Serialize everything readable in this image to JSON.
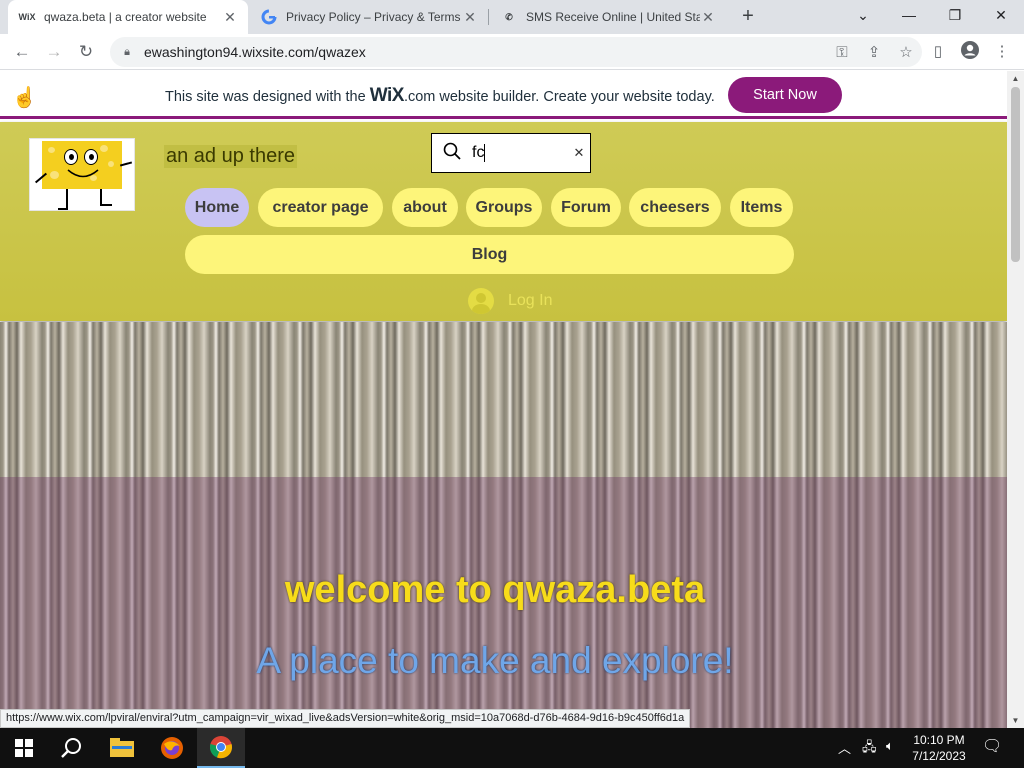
{
  "browser": {
    "tabs": [
      {
        "favicon": "WiX",
        "title": "qwaza.beta | a creator website",
        "active": true
      },
      {
        "favicon": "G",
        "title": "Privacy Policy – Privacy & Terms –",
        "active": false
      },
      {
        "favicon": "phone",
        "title": "SMS Receive Online | United State",
        "active": false
      }
    ],
    "address": "ewashington94.wixsite.com/qwazex",
    "status_url": "https://www.wix.com/lpviral/enviral?utm_campaign=vir_wixad_live&adsVersion=white&orig_msid=10a7068d-d76b-4684-9d16-b9c450ff6d1a"
  },
  "wix_banner": {
    "text_before": "This site was designed with the",
    "logo": "WiX",
    "text_after": ".com website builder. Create your website today.",
    "button": "Start Now",
    "accent": "#8b1a7a"
  },
  "site": {
    "ad_text": "an ad up there",
    "search_value": "fc",
    "nav": [
      "Home",
      "creator page",
      "about",
      "Groups",
      "Forum",
      "cheesers",
      "Items"
    ],
    "blog": "Blog",
    "login": "Log In",
    "hero_title": "welcome to qwaza.beta",
    "hero_subtitle": "A place to make and explore!",
    "colors": {
      "header": "#cfcb56",
      "pill": "#fdf57a",
      "active_pill": "#c8c3f3",
      "title": "#f7dc1a",
      "subtitle": "#6fa6e8"
    }
  },
  "taskbar": {
    "time": "10:10 PM",
    "date": "7/12/2023"
  }
}
